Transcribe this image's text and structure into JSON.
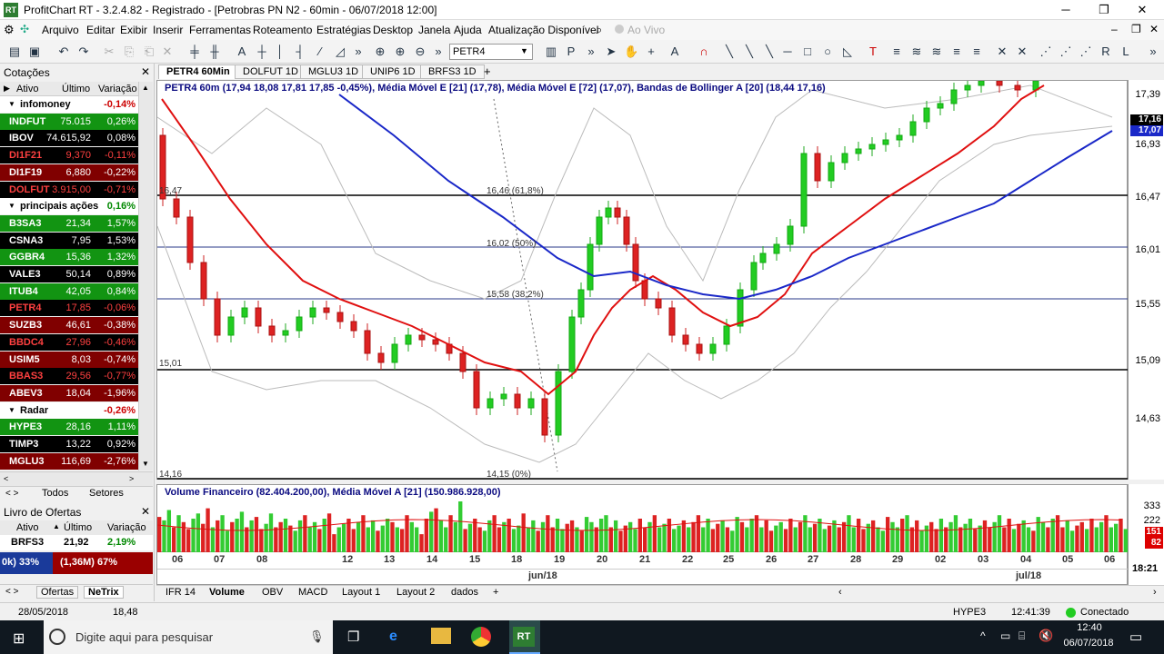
{
  "window": {
    "title": "ProfitChart RT - 3.2.4.82 - Registrado - [Petrobras PN N2 - 60min - 06/07/2018 12:00]",
    "minimize": "─",
    "maximize": "❐",
    "close": "✕"
  },
  "menu": [
    "Arquivo",
    "Editar",
    "Exibir",
    "Inserir",
    "Ferramentas",
    "Roteamento",
    "Estratégias",
    "Desktop",
    "Janela",
    "Ajuda",
    "Atualização Disponível",
    "Ao Vivo"
  ],
  "toolbar": {
    "symbol": "PETR4"
  },
  "quotes": {
    "title": "Cotações",
    "headers": [
      "Ativo",
      "Último",
      "Variação"
    ],
    "rows": [
      {
        "type": "group",
        "sym": "infomoney",
        "var": "-0,14%",
        "style": "grp"
      },
      {
        "sym": "INDFUT",
        "last": "75.015",
        "var": "0,26%",
        "style": "g"
      },
      {
        "sym": "IBOV",
        "last": "74.615,92",
        "var": "0,08%",
        "style": "k"
      },
      {
        "sym": "DI1F21",
        "last": "9,370",
        "var": "-0,11%",
        "style": "rk"
      },
      {
        "sym": "DI1F19",
        "last": "6,880",
        "var": "-0,22%",
        "style": "r"
      },
      {
        "sym": "DOLFUT",
        "last": "3.915,00",
        "var": "-0,71%",
        "style": "rk"
      },
      {
        "type": "group",
        "sym": "principais ações",
        "var": "0,16%",
        "style": "grp"
      },
      {
        "sym": "B3SA3",
        "last": "21,34",
        "var": "1,57%",
        "style": "g"
      },
      {
        "sym": "CSNA3",
        "last": "7,95",
        "var": "1,53%",
        "style": "k"
      },
      {
        "sym": "GGBR4",
        "last": "15,36",
        "var": "1,32%",
        "style": "g"
      },
      {
        "sym": "VALE3",
        "last": "50,14",
        "var": "0,89%",
        "style": "k"
      },
      {
        "sym": "ITUB4",
        "last": "42,05",
        "var": "0,84%",
        "style": "g"
      },
      {
        "sym": "PETR4",
        "last": "17,85",
        "var": "-0,06%",
        "style": "rk"
      },
      {
        "sym": "SUZB3",
        "last": "46,61",
        "var": "-0,38%",
        "style": "r"
      },
      {
        "sym": "BBDC4",
        "last": "27,96",
        "var": "-0,46%",
        "style": "rk"
      },
      {
        "sym": "USIM5",
        "last": "8,03",
        "var": "-0,74%",
        "style": "r"
      },
      {
        "sym": "BBAS3",
        "last": "29,56",
        "var": "-0,77%",
        "style": "rk"
      },
      {
        "sym": "ABEV3",
        "last": "18,04",
        "var": "-1,96%",
        "style": "r"
      },
      {
        "type": "group",
        "sym": "Radar",
        "var": "-0,26%",
        "style": "grp"
      },
      {
        "sym": "HYPE3",
        "last": "28,16",
        "var": "1,11%",
        "style": "g"
      },
      {
        "sym": "TIMP3",
        "last": "13,22",
        "var": "0,92%",
        "style": "k"
      },
      {
        "sym": "MGLU3",
        "last": "116,69",
        "var": "-2,76%",
        "style": "r"
      }
    ],
    "filter_tabs": [
      "Todos",
      "Setores"
    ]
  },
  "book": {
    "title": "Livro de Ofertas",
    "headers": [
      "Ativo",
      "Último",
      "Variação"
    ],
    "sym": "BRFS3",
    "last": "21,92",
    "var": "2,19%",
    "buy": "0k) 33%",
    "sell": "(1,36M) 67%",
    "tabs": [
      "Ofertas",
      "NeTrix"
    ]
  },
  "chart_tabs": [
    "PETR4 60Min",
    "DOLFUT 1D",
    "MGLU3 1D",
    "UNIP6 1D",
    "BRFS3 1D"
  ],
  "chart": {
    "legend": "PETR4 60m (17,94  18,08  17,81  17,85  -0,45%), Média Móvel E [21] (17,78), Média Móvel E [72] (17,07), Bandas de Bollinger A [20] (18,44  17,16)",
    "y_labels": [
      "17,39",
      "16,93",
      "16,47",
      "16,01",
      "15,55",
      "15,09",
      "14,63"
    ],
    "tags": [
      "17,16",
      "17,07"
    ],
    "fib": [
      "16,46 (61,8%)",
      "16,02 (50%)",
      "15,58 (38,2%)",
      "14,15 (0%)"
    ],
    "hlines": [
      "16,47",
      "15,01",
      "14,16"
    ],
    "volume_legend": "Volume Financeiro (82.404.200,00), Média Móvel A [21] (150.986.928,00)",
    "volume_y": [
      "333",
      "222",
      "151",
      "82"
    ],
    "x_labels": [
      "06",
      "07",
      "08",
      "12",
      "13",
      "14",
      "15",
      "18",
      "19",
      "20",
      "21",
      "22",
      "25",
      "26",
      "27",
      "28",
      "29",
      "02",
      "03",
      "04",
      "05",
      "06"
    ],
    "months": [
      "jun/18",
      "jul/18"
    ],
    "time": "18:21"
  },
  "bottom_tabs": [
    "IFR 14",
    "Volume",
    "OBV",
    "MACD",
    "Layout 1",
    "Layout 2",
    "dados"
  ],
  "status": {
    "date": "28/05/2018",
    "value": "18,48",
    "sym": "HYPE3",
    "clock": "12:41:39",
    "conn": "Conectado"
  },
  "taskbar": {
    "search": "Digite aqui para pesquisar",
    "time": "12:40",
    "date": "06/07/2018",
    "app": "RT"
  },
  "chart_data": {
    "type": "line",
    "series": [
      {
        "name": "Média Móvel E [21]",
        "values": [
          17.78
        ]
      },
      {
        "name": "Média Móvel E [72]",
        "values": [
          17.07
        ]
      }
    ]
  }
}
